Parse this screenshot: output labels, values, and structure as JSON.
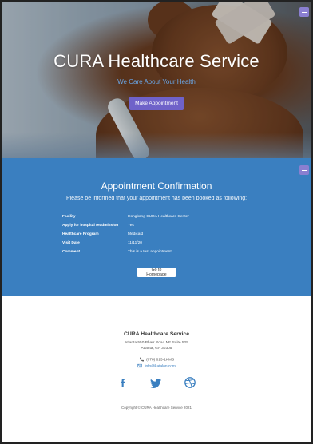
{
  "hero": {
    "title": "CURA Healthcare Service",
    "subtitle": "We Care About Your Health",
    "cta_label": "Make Appointment"
  },
  "confirmation": {
    "title": "Appointment Confirmation",
    "subtitle": "Please be informed that your appointment has been booked as following:",
    "rows": [
      {
        "label": "Facility",
        "value": "Hongkong CURA Healthcare Center"
      },
      {
        "label": "Apply for hospital readmission",
        "value": "Yes"
      },
      {
        "label": "Healthcare Program",
        "value": "Medicaid"
      },
      {
        "label": "Visit Date",
        "value": "11/11/20"
      },
      {
        "label": "Comment",
        "value": "This is a test appointment"
      }
    ],
    "home_button_label": "Go to Homepage"
  },
  "footer": {
    "title": "CURA Healthcare Service",
    "address_line1": "Atlanta 550 Pharr Road NE Suite 525",
    "address_line2": "Atlanta, GA 30305",
    "phone": "(678) 813-1KMS",
    "email": "info@katalon.com",
    "copyright": "Copyright © CURA Healthcare Service 2021"
  },
  "icons": {
    "menu": "hamburger-menu-icon",
    "phone": "phone-icon",
    "email": "email-icon",
    "facebook": "facebook-icon",
    "twitter": "twitter-icon",
    "dribbble": "dribbble-icon"
  },
  "colors": {
    "primary_blue": "#3a7fc0",
    "accent_purple": "#6f62c9",
    "menu_toggle": "#8a7fd0"
  }
}
